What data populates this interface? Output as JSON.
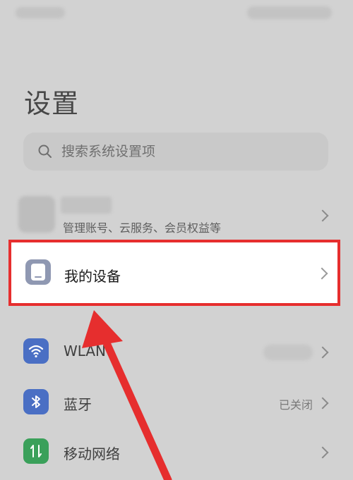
{
  "page": {
    "title": "设置"
  },
  "search": {
    "placeholder": "搜索系统设置项"
  },
  "account": {
    "subtitle": "管理账号、云服务、会员权益等"
  },
  "highlighted_item": {
    "label": "我的设备"
  },
  "items": [
    {
      "label": "WLAN",
      "status": "",
      "icon": "wifi-icon",
      "color": "#4a6fc4"
    },
    {
      "label": "蓝牙",
      "status": "已关闭",
      "icon": "bluetooth-icon",
      "color": "#4a6fc4"
    },
    {
      "label": "移动网络",
      "status": "",
      "icon": "mobile-network-icon",
      "color": "#3aa05a"
    }
  ],
  "annotation": {
    "color": "#e62e2e"
  }
}
